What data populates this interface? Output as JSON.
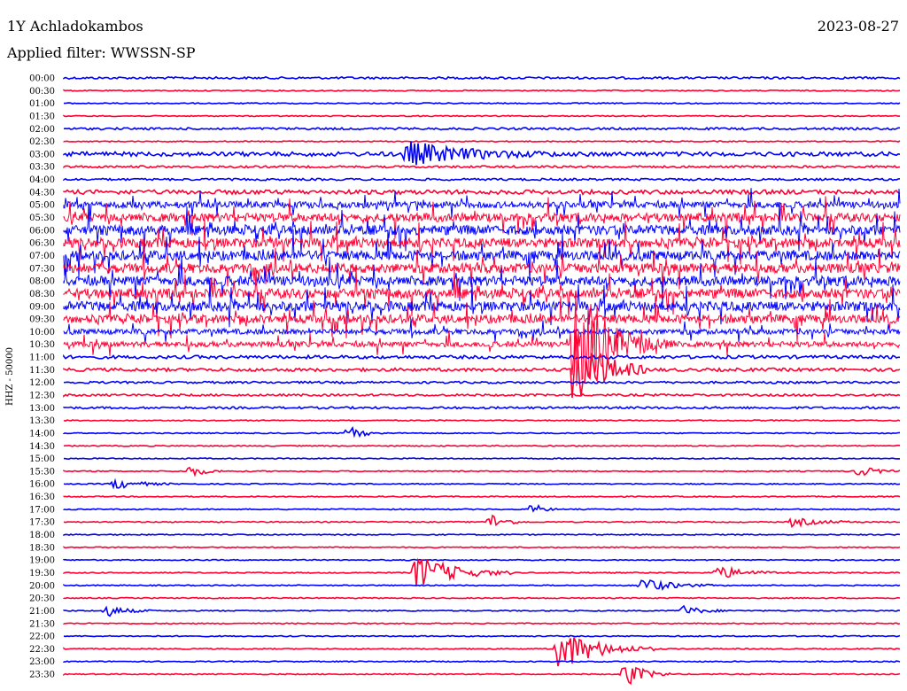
{
  "header": {
    "station": "1Y Achladokambos",
    "date": "2023-08-27",
    "filter": "Applied filter: WWSSN-SP"
  },
  "chart_data": {
    "type": "line",
    "title": "1Y Achladokambos",
    "ylabel": "HHZ - 50000",
    "trace_labels": [
      "00:00",
      "00:30",
      "01:00",
      "01:30",
      "02:00",
      "02:30",
      "03:00",
      "03:30",
      "04:00",
      "04:30",
      "05:00",
      "05:30",
      "06:00",
      "06:30",
      "07:00",
      "07:30",
      "08:00",
      "08:30",
      "09:00",
      "09:30",
      "10:00",
      "10:30",
      "11:00",
      "11:30",
      "12:00",
      "12:30",
      "13:00",
      "13:30",
      "14:00",
      "14:30",
      "15:00",
      "15:30",
      "16:00",
      "16:30",
      "17:00",
      "17:30",
      "18:00",
      "18:30",
      "19:00",
      "19:30",
      "20:00",
      "20:30",
      "21:00",
      "21:30",
      "22:00",
      "22:30",
      "23:00",
      "23:30"
    ],
    "trace_colors": [
      "#0000ff",
      "#ff0033"
    ],
    "trace_amplitude": [
      2,
      1,
      1,
      1,
      2,
      1,
      4,
      2,
      2,
      4,
      6,
      8,
      9,
      9,
      9,
      9,
      9,
      9,
      9,
      8,
      5,
      5,
      3,
      3,
      2,
      2,
      2,
      1,
      1,
      1,
      1,
      1,
      1,
      1,
      1,
      1,
      1,
      1,
      1,
      1,
      1,
      1,
      1,
      1,
      1,
      1,
      1,
      1
    ],
    "events": [
      {
        "row": 6,
        "x": 0.41,
        "amp": 14,
        "dur": 0.06
      },
      {
        "row": 21,
        "x": 0.61,
        "amp": 60,
        "dur": 0.04
      },
      {
        "row": 23,
        "x": 0.61,
        "amp": 50,
        "dur": 0.03
      },
      {
        "row": 28,
        "x": 0.34,
        "amp": 8,
        "dur": 0.015
      },
      {
        "row": 31,
        "x": 0.15,
        "amp": 7,
        "dur": 0.015
      },
      {
        "row": 31,
        "x": 0.95,
        "amp": 6,
        "dur": 0.02
      },
      {
        "row": 32,
        "x": 0.06,
        "amp": 6,
        "dur": 0.025
      },
      {
        "row": 34,
        "x": 0.56,
        "amp": 8,
        "dur": 0.01
      },
      {
        "row": 35,
        "x": 0.51,
        "amp": 10,
        "dur": 0.015
      },
      {
        "row": 35,
        "x": 0.87,
        "amp": 5,
        "dur": 0.03
      },
      {
        "row": 39,
        "x": 0.42,
        "amp": 22,
        "dur": 0.04
      },
      {
        "row": 39,
        "x": 0.78,
        "amp": 8,
        "dur": 0.03
      },
      {
        "row": 40,
        "x": 0.69,
        "amp": 9,
        "dur": 0.03
      },
      {
        "row": 42,
        "x": 0.05,
        "amp": 7,
        "dur": 0.02
      },
      {
        "row": 42,
        "x": 0.74,
        "amp": 6,
        "dur": 0.02
      },
      {
        "row": 45,
        "x": 0.59,
        "amp": 26,
        "dur": 0.04
      },
      {
        "row": 47,
        "x": 0.67,
        "amp": 16,
        "dur": 0.02
      }
    ]
  }
}
